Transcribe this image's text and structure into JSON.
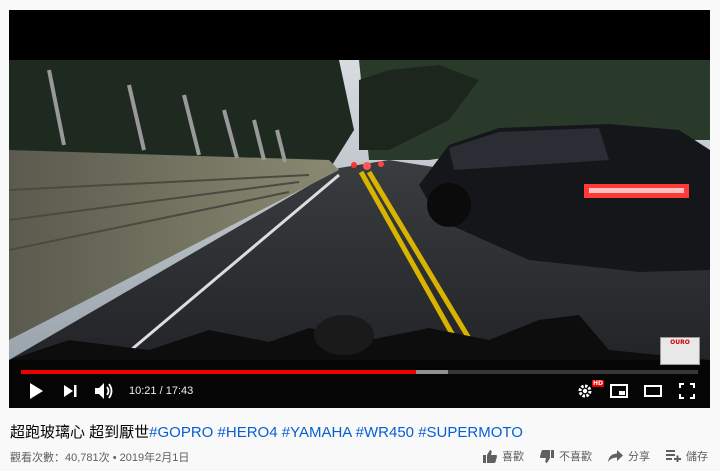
{
  "player": {
    "current_time": "10:21",
    "separator": "/",
    "duration": "17:43",
    "played_fraction": 0.584,
    "loaded_fraction": 0.63,
    "hd_badge": "HD",
    "watermark_text": "OURO"
  },
  "icons": {
    "play": "play-icon",
    "next": "next-icon",
    "volume": "volume-icon",
    "settings": "settings-icon",
    "miniplayer": "miniplayer-icon",
    "theater": "theater-icon",
    "fullscreen": "fullscreen-icon"
  },
  "video": {
    "title_plain": "超跑玻璃心 超到厭世",
    "hashtags": [
      "#GOPRO",
      "#HERO4",
      "#YAMAHA",
      "#WR450",
      "#SUPERMOTO"
    ],
    "views": "觀看次數：40,781次",
    "dot": "•",
    "date": "2019年2月1日"
  },
  "actions": {
    "like": "喜歡",
    "dislike": "不喜歡",
    "share": "分享",
    "save": "儲存"
  },
  "colors": {
    "progress": "#ff0000",
    "hashtag": "#065fd4"
  }
}
